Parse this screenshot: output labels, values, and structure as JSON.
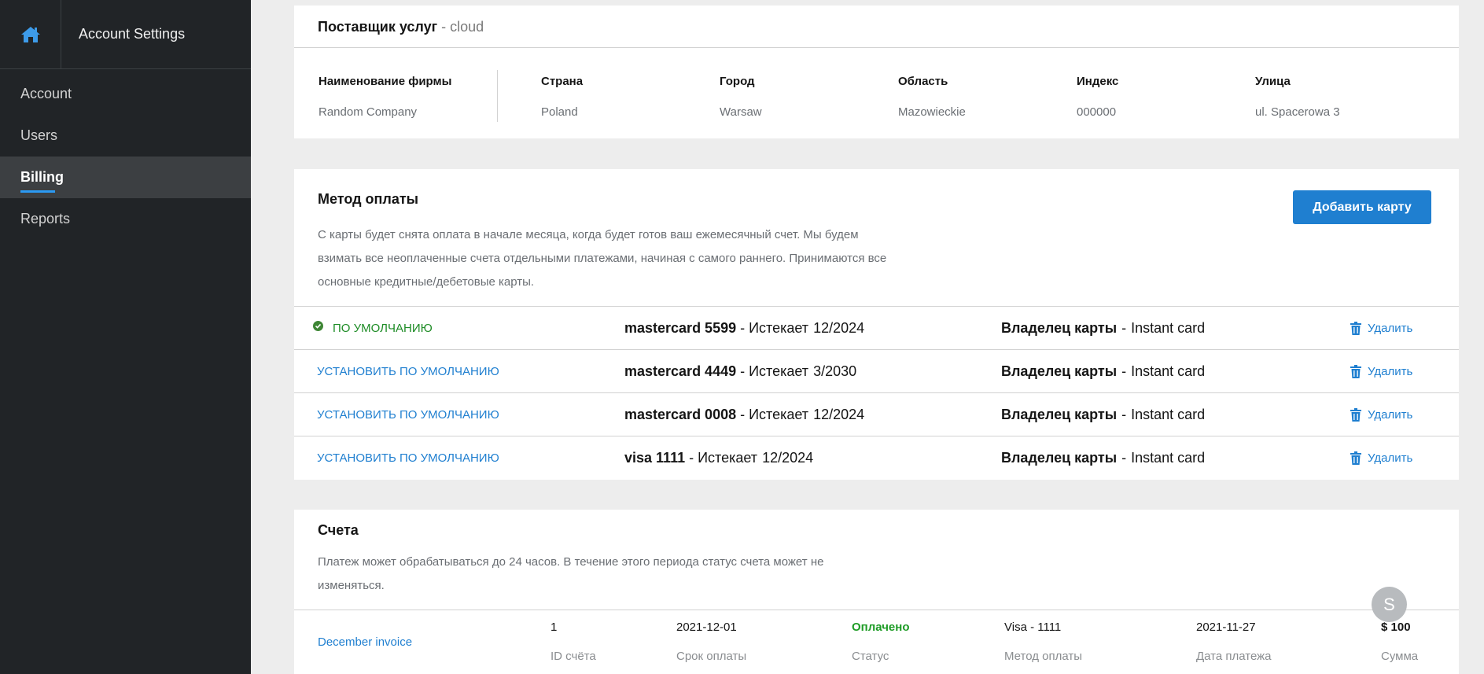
{
  "sidebar": {
    "title": "Account Settings",
    "items": [
      {
        "label": "Account"
      },
      {
        "label": "Users"
      },
      {
        "label": "Billing"
      },
      {
        "label": "Reports"
      }
    ],
    "active_index": 2
  },
  "provider": {
    "title": "Поставщик услуг",
    "subtitle": "- cloud",
    "columns": [
      {
        "label": "Наименование фирмы",
        "value": "Random Company"
      },
      {
        "label": "Страна",
        "value": "Poland"
      },
      {
        "label": "Город",
        "value": "Warsaw"
      },
      {
        "label": "Область",
        "value": "Mazowieckie"
      },
      {
        "label": "Индекс",
        "value": "000000"
      },
      {
        "label": "Улица",
        "value": "ul. Spacerowa 3"
      }
    ]
  },
  "payment": {
    "title": "Метод оплаты",
    "add_button": "Добавить карту",
    "description_lines": [
      "С карты будет снята оплата в начале месяца, когда будет готов ваш ежемесячный счет. Мы будем",
      "взимать все неоплаченные счета отдельными платежами, начиная с самого раннего. Принимаются все",
      "основные кредитные/дебетовые карты."
    ],
    "default_label": "ПО УМОЛЧАНИЮ",
    "set_default_label": "УСТАНОВИТЬ ПО УМОЛЧАНИЮ",
    "expires_label": "- Истекает",
    "owner_label": "Владелец карты",
    "delete_label": "Удалить",
    "cards": [
      {
        "name": "mastercard 5599",
        "expiry": "12/2024",
        "owner": "Instant card",
        "is_default": true
      },
      {
        "name": "mastercard 4449",
        "expiry": "3/2030",
        "owner": "Instant card",
        "is_default": false
      },
      {
        "name": "mastercard 0008",
        "expiry": "12/2024",
        "owner": "Instant card",
        "is_default": false
      },
      {
        "name": "visa 1111",
        "expiry": "12/2024",
        "owner": "Instant card",
        "is_default": false
      }
    ]
  },
  "invoices": {
    "title": "Счета",
    "description_lines": [
      "Платеж может обрабатываться до 24 часов. В течение этого периода статус счета может не",
      "изменяться."
    ],
    "rows": [
      {
        "name": "December invoice",
        "id": "1",
        "id_label": "ID счёта",
        "due": "2021-12-01",
        "due_label": "Срок оплаты",
        "status": "Оплачено",
        "status_label": "Статус",
        "method": "Visa - 1111",
        "method_label": "Метод оплаты",
        "paid_date": "2021-11-27",
        "paid_date_label": "Дата платежа",
        "amount": "$ 100",
        "amount_label": "Сумма"
      }
    ]
  },
  "avatar": {
    "initial": "S"
  },
  "colors": {
    "accent": "#1f7fd0",
    "success": "#1e9c26",
    "sidebar": "#212427"
  }
}
